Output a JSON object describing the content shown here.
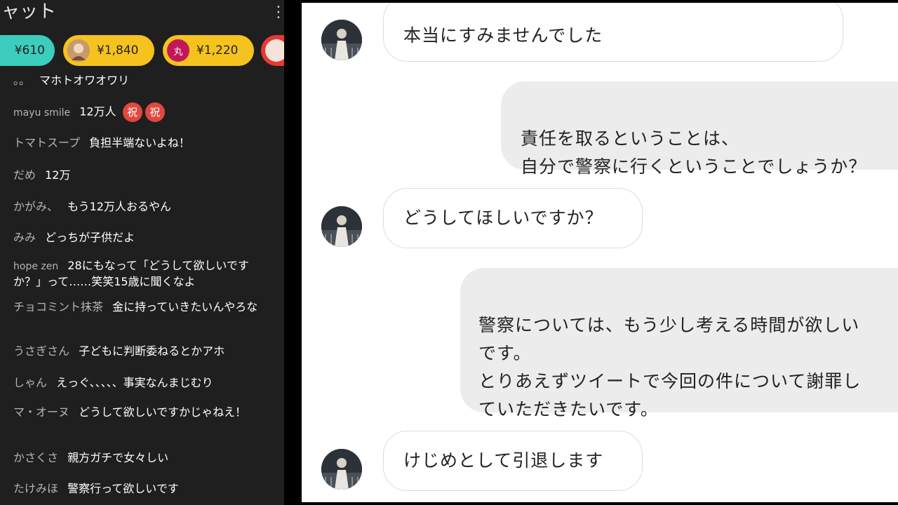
{
  "chat": {
    "title": "ャット",
    "tips": [
      {
        "amount": "¥610",
        "color": "#3ccdbd",
        "avatar": ""
      },
      {
        "amount": "¥1,840",
        "color": "#f6c21e",
        "avatar": ""
      },
      {
        "amount": "¥1,220",
        "color": "#f6c21e",
        "avatar": "丸"
      }
    ],
    "messages": [
      {
        "author": "。。",
        "text": "マホトオワオワリ"
      },
      {
        "author": "mayu smile",
        "text": "12万人",
        "badges": [
          "祝",
          "祝"
        ]
      },
      {
        "author": "トマトスープ",
        "text": "負担半端ないよね！"
      },
      {
        "author": "だめ",
        "text": "12万"
      },
      {
        "author": "かがみ、",
        "text": "もう12万人おるやん"
      },
      {
        "author": "みみ",
        "text": "どっちが子供だよ"
      },
      {
        "author": "hope zen",
        "text": "28にもなって「どうして欲しいですか？」って……笑笑15歳に聞くなよ"
      },
      {
        "author": "チョコミント抹茶",
        "text": "金に持っていきたいんやろな"
      },
      {
        "author": "うさぎさん",
        "text": "子どもに判断委ねるとかアホ"
      },
      {
        "author": "しゃん",
        "text": "えっぐ、、、、、事実なんまじむり"
      },
      {
        "author": "マ・オーヌ",
        "text": "どうして欲しいですかじゃねえ！"
      },
      {
        "author": "かさくさ",
        "text": "親方ガチで女々しい"
      },
      {
        "author": "たけみほ",
        "text": "警察行って欲しいです"
      }
    ]
  },
  "dm": {
    "messages": [
      {
        "direction": "in",
        "text": "本当にすみませんでした"
      },
      {
        "direction": "out",
        "text": "責任を取るということは、\n自分で警察に行くということでしょうか？"
      },
      {
        "direction": "in",
        "text": "どうしてほしいですか？"
      },
      {
        "direction": "out",
        "text": "警察については、もう少し考える時間が欲しい\nです。\nとりあえずツイートで今回の件について謝罪し\nていただきたいです。"
      },
      {
        "direction": "in",
        "text": "けじめとして引退します"
      }
    ]
  }
}
